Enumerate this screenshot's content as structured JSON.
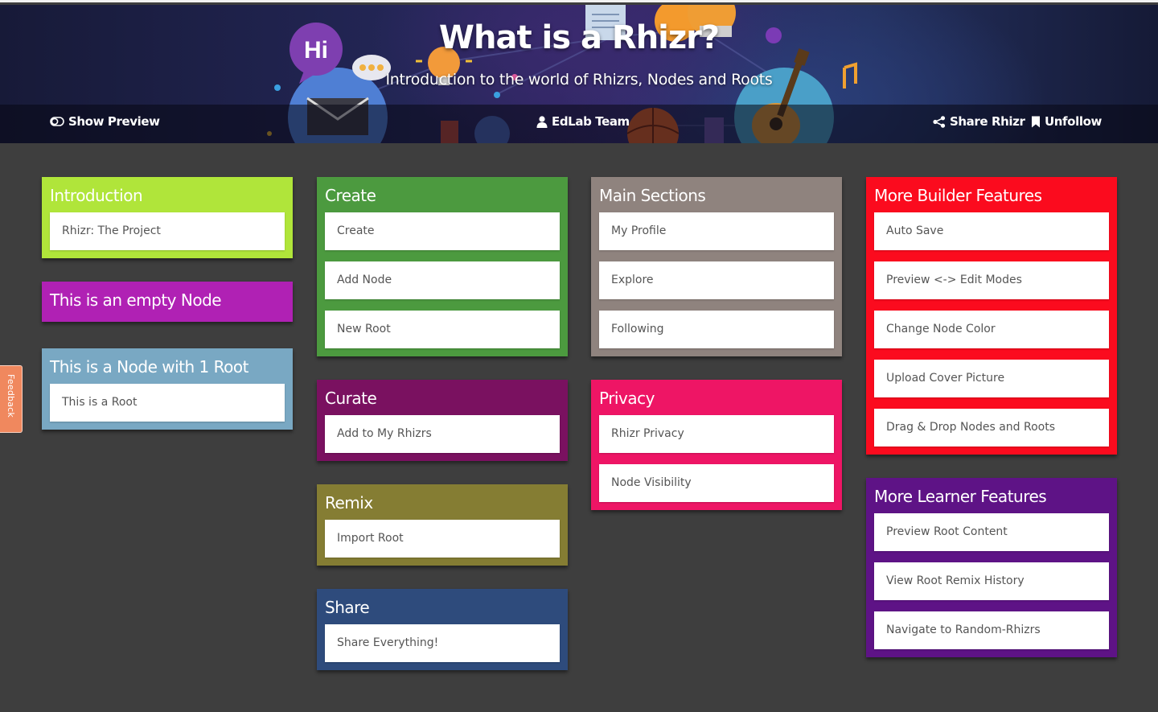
{
  "header": {
    "title": "What is a Rhizr?",
    "subtitle": "Introduction to the world of Rhizrs, Nodes and Roots",
    "bubble_text": "Hi",
    "show_preview_label": "Show Preview",
    "author_label": "EdLab Team",
    "share_label": "Share Rhizr",
    "unfollow_label": "Unfollow"
  },
  "feedback_label": "Feedback",
  "nodes": [
    {
      "title": "Introduction",
      "color": "#b0e53a",
      "roots": [
        "Rhizr: The Project"
      ]
    },
    {
      "title": "This is an empty Node",
      "color": "#b021b4",
      "roots": []
    },
    {
      "title": "This is a Node with 1 Root",
      "color": "#79a8c3",
      "roots": [
        "This is a Root"
      ]
    },
    {
      "title": "Create",
      "color": "#4c9a3f",
      "roots": [
        "Create",
        "Add Node",
        "New Root"
      ]
    },
    {
      "title": "Curate",
      "color": "#7a1160",
      "roots": [
        "Add to My Rhizrs"
      ]
    },
    {
      "title": "Remix",
      "color": "#857d33",
      "roots": [
        "Import Root"
      ]
    },
    {
      "title": "Share",
      "color": "#2e4b7c",
      "roots": [
        "Share Everything!"
      ]
    },
    {
      "title": "Main Sections",
      "color": "#8f837e",
      "roots": [
        "My Profile",
        "Explore",
        "Following"
      ]
    },
    {
      "title": "Privacy",
      "color": "#ee1565",
      "roots": [
        "Rhizr Privacy",
        "Node Visibility"
      ]
    },
    {
      "title": "More Builder Features",
      "color": "#fb0b1e",
      "roots": [
        "Auto Save",
        "Preview <-> Edit Modes",
        "Change Node Color",
        "Upload Cover Picture",
        "Drag & Drop Nodes and Roots"
      ]
    },
    {
      "title": "More Learner Features",
      "color": "#5e1386",
      "roots": [
        "Preview Root Content",
        "View Root Remix History",
        "Navigate to Random-Rhizrs"
      ]
    }
  ]
}
